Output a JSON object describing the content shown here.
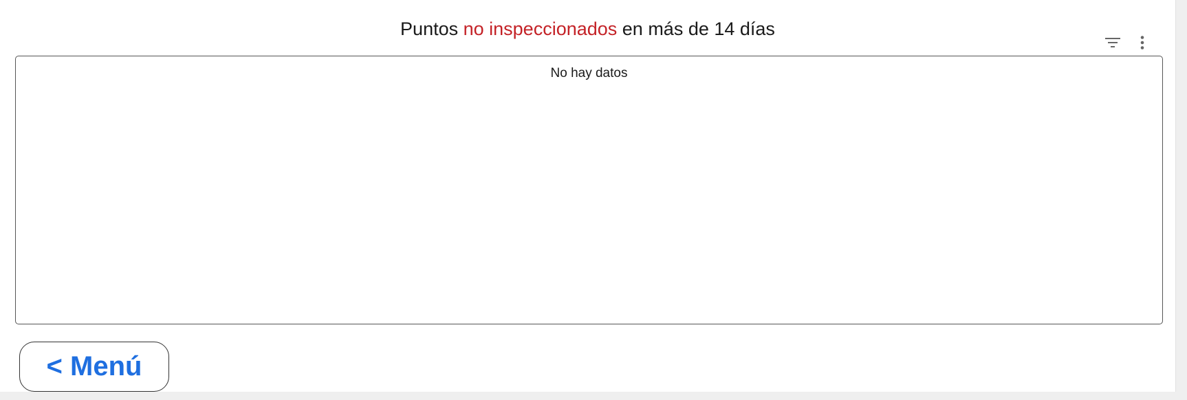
{
  "header": {
    "title_prefix": "Puntos ",
    "title_accent": "no inspeccionados",
    "title_suffix": " en más de 14 días",
    "accent_color": "#c42227"
  },
  "toolbar": {
    "filter_icon": "filter-icon",
    "more_icon": "more-vertical-icon"
  },
  "table": {
    "empty_message": "No hay datos",
    "rows": []
  },
  "footer": {
    "menu_button_label": "< Menú",
    "menu_button_color": "#1f6fe0"
  }
}
